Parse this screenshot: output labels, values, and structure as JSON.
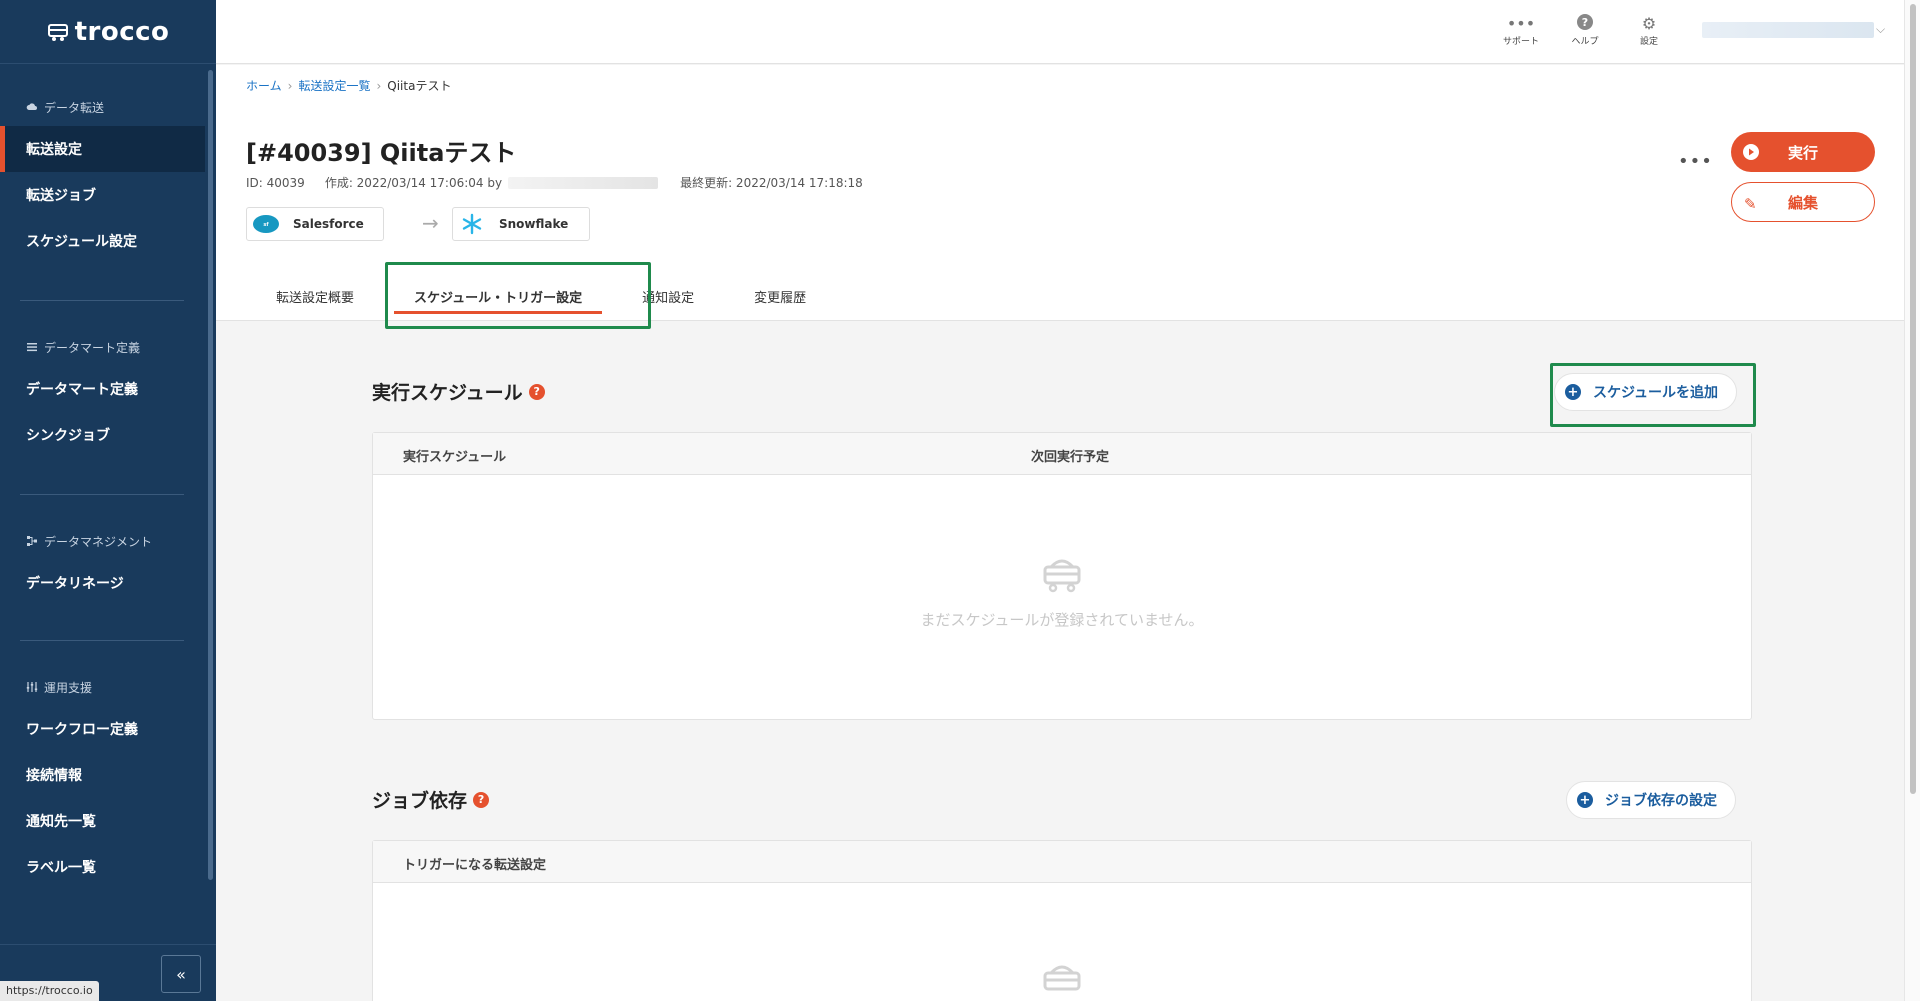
{
  "sidebar": {
    "logo": "trocco",
    "groups": [
      {
        "heading": "データ転送",
        "items": [
          {
            "label": "転送設定",
            "active": true
          },
          {
            "label": "転送ジョブ"
          },
          {
            "label": "スケジュール設定"
          }
        ]
      },
      {
        "heading": "データマート定義",
        "items": [
          {
            "label": "データマート定義"
          },
          {
            "label": "シンクジョブ"
          }
        ]
      },
      {
        "heading": "データマネジメント",
        "items": [
          {
            "label": "データリネージ"
          }
        ]
      },
      {
        "heading": "運用支援",
        "items": [
          {
            "label": "ワークフロー定義"
          },
          {
            "label": "接続情報"
          },
          {
            "label": "通知先一覧"
          },
          {
            "label": "ラベル一覧"
          }
        ]
      }
    ],
    "collapse_label": "«",
    "status_url": "https://trocco.io"
  },
  "topbar": {
    "support": "サポート",
    "help": "ヘルプ",
    "settings": "設定"
  },
  "breadcrumb": {
    "home": "ホーム",
    "list": "転送設定一覧",
    "current": "Qiitaテスト"
  },
  "header": {
    "title": "[#40039] Qiitaテスト",
    "id_text": "ID: 40039",
    "created_text": "作成: 2022/03/14 17:06:04 by",
    "updated_text": "最終更新: 2022/03/14 17:18:18",
    "source": "Salesforce",
    "destination": "Snowflake",
    "more": "•••",
    "run_label": "実行",
    "edit_label": "編集"
  },
  "tabs": [
    {
      "label": "転送設定概要"
    },
    {
      "label": "スケジュール・トリガー設定",
      "active": true
    },
    {
      "label": "通知設定"
    },
    {
      "label": "変更履歴"
    }
  ],
  "schedule": {
    "title": "実行スケジュール",
    "add_button": "スケジュールを追加",
    "col_schedule": "実行スケジュール",
    "col_next": "次回実行予定",
    "empty": "まだスケジュールが登録されていません。"
  },
  "dependency": {
    "title": "ジョブ依存",
    "settings_button": "ジョブ依存の設定",
    "col_trigger": "トリガーになる転送設定"
  },
  "colors": {
    "accent": "#e5512e",
    "sidebar": "#193a5c",
    "link": "#1b73c5",
    "highlight": "#1f8a4c"
  }
}
